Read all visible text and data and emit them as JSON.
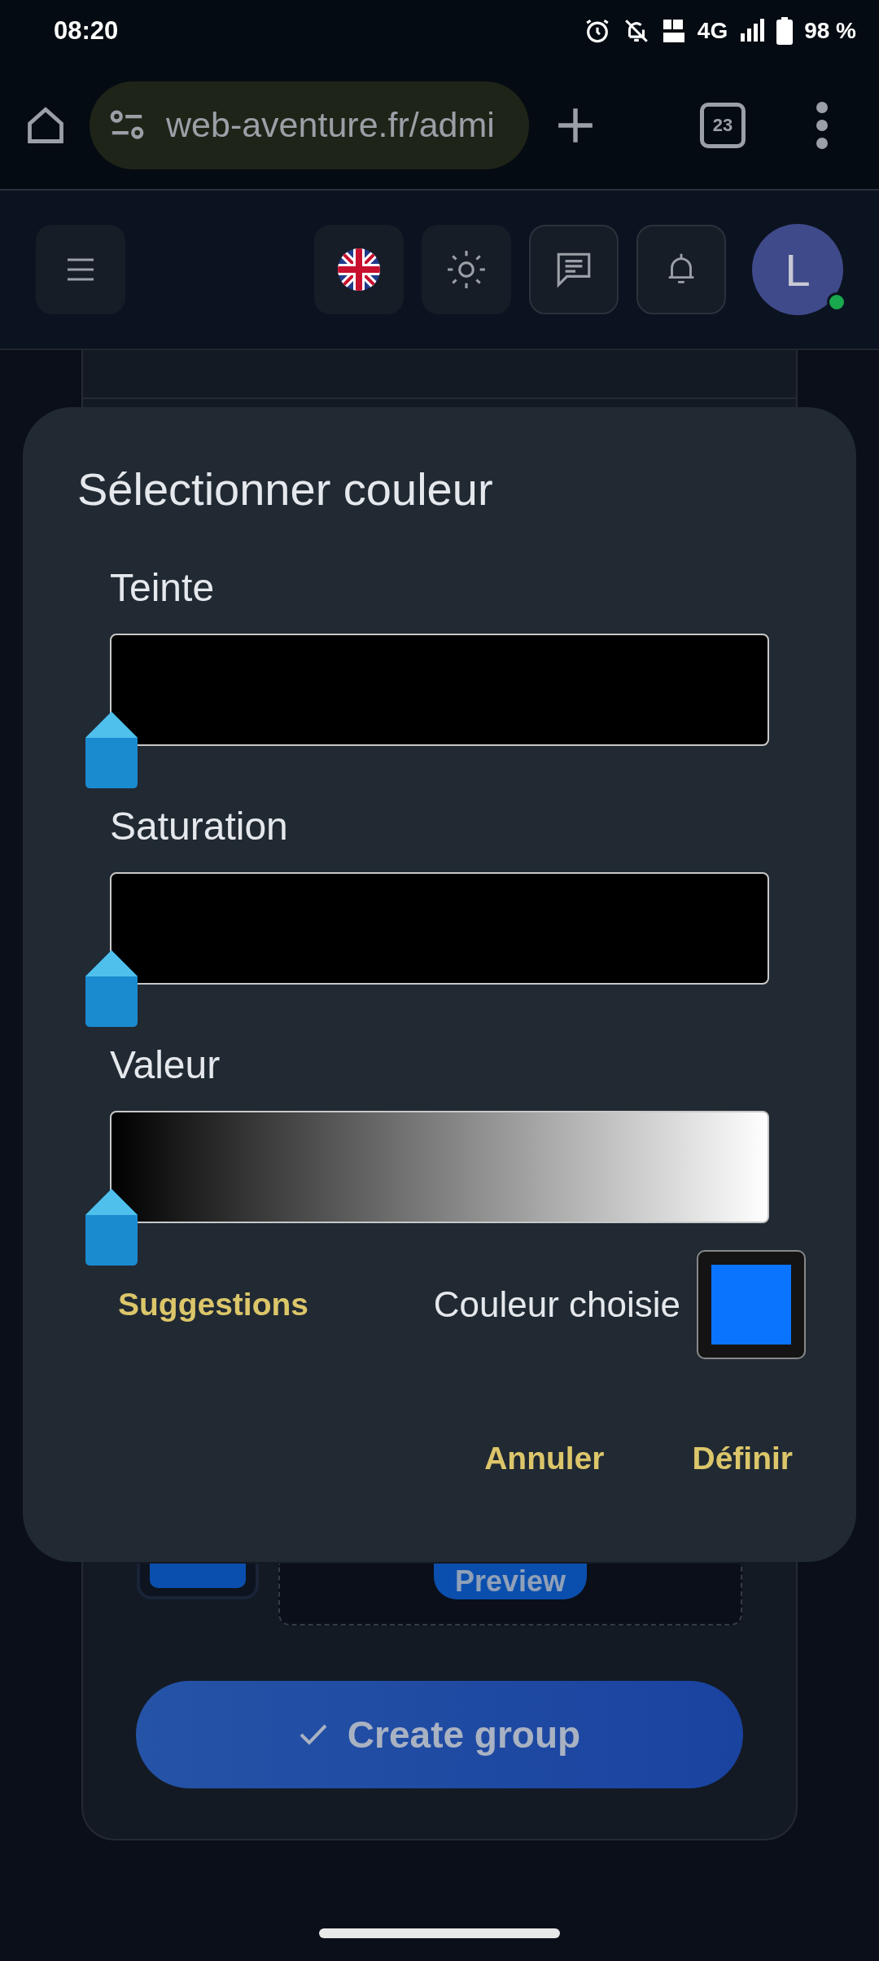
{
  "status_bar": {
    "time": "08:20",
    "network": "4G",
    "battery": "98 %"
  },
  "browser": {
    "url": "web-aventure.fr/admi",
    "tab_count": "23"
  },
  "app_header": {
    "avatar_letter": "L",
    "online": true
  },
  "form": {
    "preview_label": "Preview",
    "submit": "Create group"
  },
  "dialog": {
    "title": "Sélectionner couleur",
    "sliders": [
      {
        "label": "Teinte",
        "kind": "solid",
        "level": 0
      },
      {
        "label": "Saturation",
        "kind": "solid",
        "level": 0
      },
      {
        "label": "Valeur",
        "kind": "gradient",
        "level": 0
      }
    ],
    "suggestions": "Suggestions",
    "chosen_label": "Couleur choisie",
    "buttons": [
      "Annuler",
      "Définir"
    ]
  }
}
